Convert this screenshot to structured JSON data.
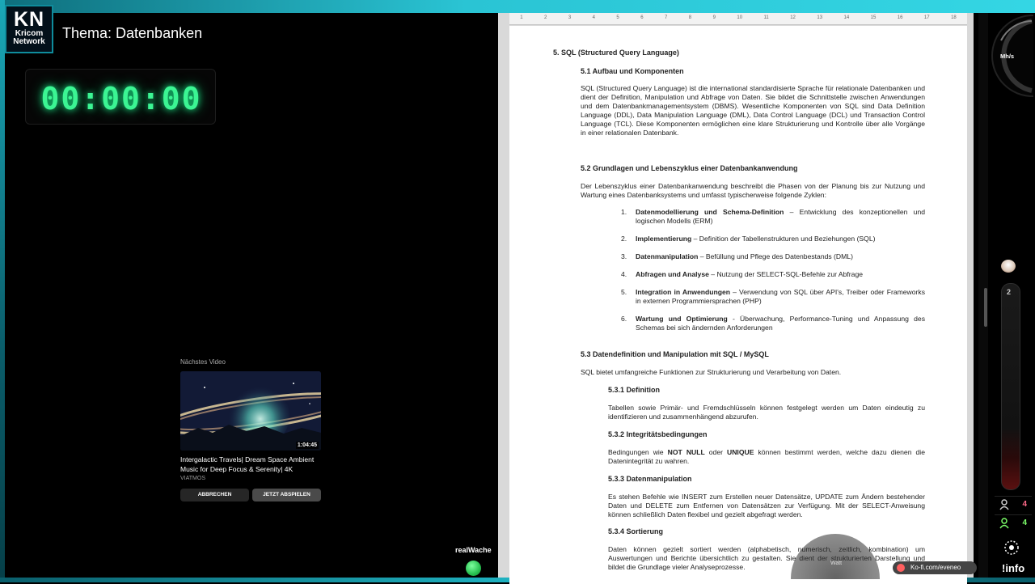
{
  "brand": {
    "logo_main": "KN",
    "logo_sub_1": "Kricom",
    "logo_sub_2": "Network"
  },
  "topic": "Thema: Datenbanken",
  "timer": "00:00:00",
  "next_video": {
    "label": "Nächstes Video",
    "duration": "1:04:45",
    "title": "Intergalactic Travels| Dream Space Ambient Music for Deep Focus & Serenity| 4K",
    "channel": "VIATMOS",
    "cancel_label": "ABBRECHEN",
    "play_label": "JETZT ABSPIELEN"
  },
  "realwache": "realWache",
  "ruler": [
    "1",
    "2",
    "3",
    "4",
    "5",
    "6",
    "7",
    "8",
    "9",
    "10",
    "11",
    "12",
    "13",
    "14",
    "15",
    "16",
    "17",
    "18"
  ],
  "doc": {
    "h_5": "5. SQL (Structured Query Language)",
    "h_5_1": "5.1 Aufbau und Komponenten",
    "p_5_1": "SQL (Structured Query Language) ist die international standardisierte Sprache für relationale Datenbanken und dient der Definition, Manipulation und Abfrage von Daten. Sie bildet die Schnittstelle zwischen Anwendungen und dem Datenbankmanagementsystem (DBMS). Wesentliche Komponenten von SQL sind Data Definition Language (DDL), Data Manipulation Language (DML), Data Control Language (DCL) und Transaction Control Language (TCL). Diese Komponenten ermöglichen eine klare Strukturierung und Kontrolle über alle Vorgänge in einer relationalen Datenbank.",
    "h_5_2": "5.2 Grundlagen und Lebenszyklus einer Datenbankanwendung",
    "p_5_2": "Der Lebenszyklus einer Datenbankanwendung beschreibt die Phasen von der Planung bis zur Nutzung und Wartung eines Datenbanksystems und umfasst typischerweise folgende Zyklen:",
    "list": [
      {
        "num": "1.",
        "bold": "Datenmodellierung und Schema-Definition",
        "text": " – Entwicklung des konzeptionellen und logischen Modells (ERM)"
      },
      {
        "num": "2.",
        "bold": "Implementierung",
        "text": " – Definition der Tabellenstrukturen und Beziehungen (SQL)"
      },
      {
        "num": "3.",
        "bold": "Datenmanipulation",
        "text": " – Befüllung und Pflege des Datenbestands (DML)"
      },
      {
        "num": "4.",
        "bold": "Abfragen und Analyse",
        "text": " – Nutzung der SELECT-SQL-Befehle zur Abfrage"
      },
      {
        "num": "5.",
        "bold": "Integration in Anwendungen",
        "text": " – Verwendung von SQL über API's, Treiber oder Frameworks in externen Programmiersprachen (PHP)"
      },
      {
        "num": "6.",
        "bold": "Wartung und Optimierung",
        "text": " - Überwachung, Performance-Tuning und Anpassung des Schemas bei sich ändernden Anforderungen"
      }
    ],
    "h_5_3": "5.3 Datendefinition und Manipulation mit SQL / MySQL",
    "p_5_3": "SQL bietet umfangreiche Funktionen zur Strukturierung und Verarbeitung von Daten.",
    "h_5_3_1": "5.3.1 Definition",
    "p_5_3_1": "Tabellen sowie Primär- und Fremdschlüsseln können festgelegt werden um Daten eindeutig zu identifizieren und zusammenhängend abzurufen.",
    "h_5_3_2": "5.3.2 Integritätsbedingungen",
    "p_5_3_2_a": "Bedingungen wie ",
    "p_5_3_2_b": "NOT NULL",
    "p_5_3_2_c": " oder ",
    "p_5_3_2_d": "UNIQUE",
    "p_5_3_2_e": " können bestimmt werden, welche dazu dienen die Datenintegrität zu wahren.",
    "h_5_3_3": "5.3.3 Datenmanipulation",
    "p_5_3_3": "Es stehen Befehle wie INSERT zum Erstellen neuer Datensätze, UPDATE zum Ändern bestehender Daten und DELETE zum Entfernen von Datensätzen zur Verfügung. Mit der SELECT-Anweisung können schließlich Daten flexibel und gezielt abgefragt werden.",
    "h_5_3_4": "5.3.4 Sortierung",
    "p_5_3_4": "Daten können gezielt sortiert werden (alphabetisch, numerisch, zeitlich, kombination) um Auswertungen und Berichte übersichtlich zu gestalten. Sie dient der strukturierten Darstellung und bildet die Grundlage vieler Analyseprozesse."
  },
  "gauge_label": "Mh/s",
  "tube_value": "2",
  "stats": [
    {
      "value": "4",
      "color": "#ff6a8a"
    },
    {
      "value": "4",
      "color": "#7dff6a"
    }
  ],
  "info_label": "!info",
  "kofi": "Ko-fi.com/eveneo",
  "watt_label": "Watt"
}
